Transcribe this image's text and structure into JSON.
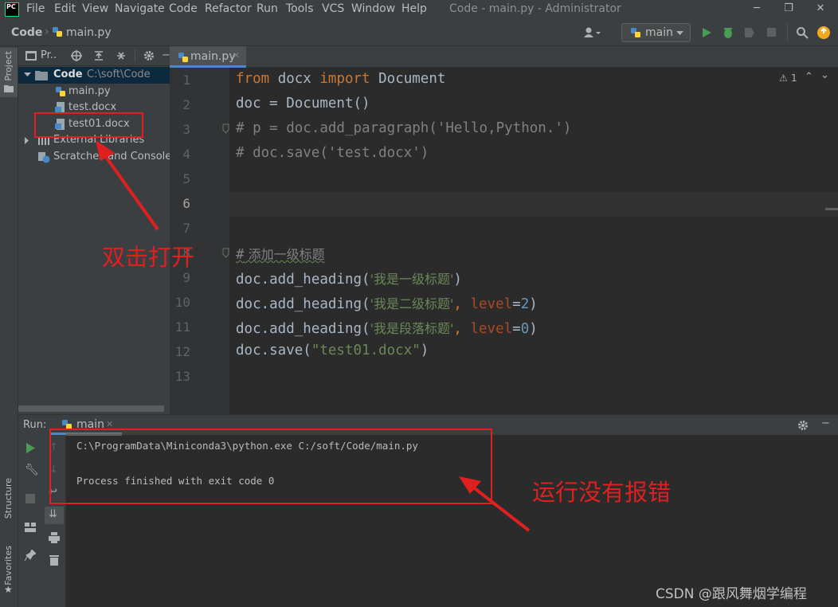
{
  "app": {
    "logo": "PC",
    "menu": [
      "File",
      "Edit",
      "View",
      "Navigate",
      "Code",
      "Refactor",
      "Run",
      "Tools",
      "VCS",
      "Window",
      "Help"
    ],
    "window_title": "Code - main.py - Administrator"
  },
  "breadcrumb": {
    "project": "Code",
    "file": "main.py"
  },
  "toolbar": {
    "run_config": "main"
  },
  "project_panel": {
    "header_label": "Pr..",
    "root_name": "Code",
    "root_path": "C:\\soft\\Code",
    "files": [
      "main.py",
      "test.docx",
      "test01.docx"
    ],
    "external_libraries": "External Libraries",
    "scratches": "Scratches and Consoles"
  },
  "side_tabs": {
    "project": "Project",
    "structure": "Structure",
    "favorites": "Favorites"
  },
  "editor": {
    "tab_label": "main.py",
    "warning_count": "1",
    "line_numbers": [
      "1",
      "2",
      "3",
      "4",
      "5",
      "6",
      "7",
      "8",
      "9",
      "10",
      "11",
      "12",
      "13"
    ],
    "code": {
      "l1_kw1": "from",
      "l1_mod": " docx ",
      "l1_kw2": "import",
      "l1_name": " Document",
      "l2": "doc = Document()",
      "l3": "# p = doc.add_paragraph('Hello,Python.')",
      "l4": "# doc.save('test.docx')",
      "l8_hash": "#",
      "l8_text": " 添加一级标题",
      "l9_a": "doc.add_heading(",
      "l9_s": "'我是一级标题'",
      "l9_b": ")",
      "l10_a": "doc.add_heading(",
      "l10_s": "'我是二级标题'",
      "l10_sep": ", ",
      "l10_p": "level",
      "l10_eq": "=",
      "l10_n": "2",
      "l10_b": ")",
      "l11_a": "doc.add_heading(",
      "l11_s": "'我是段落标题'",
      "l11_sep": ", ",
      "l11_p": "level",
      "l11_eq": "=",
      "l11_n": "0",
      "l11_b": ")",
      "l12_a": "doc.save(",
      "l12_s": "\"test01.docx\"",
      "l12_b": ")"
    }
  },
  "run_panel": {
    "label": "Run:",
    "tab": "main",
    "output": [
      "C:\\ProgramData\\Miniconda3\\python.exe C:/soft/Code/main.py",
      "",
      "Process finished with exit code 0"
    ]
  },
  "annotations": {
    "double_click": "双击打开",
    "no_error": "运行没有报错"
  },
  "watermark": "CSDN @跟风舞烟学编程",
  "colors": {
    "background": "#2b2b2b",
    "panel": "#3c3f41",
    "keyword": "#cc7832",
    "string": "#6a8759",
    "number": "#6897bb",
    "annotation_red": "#e02020",
    "run_green": "#499c54"
  }
}
